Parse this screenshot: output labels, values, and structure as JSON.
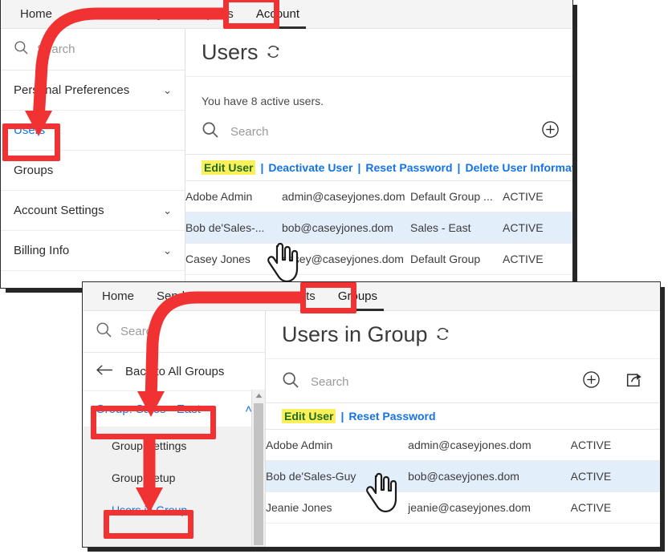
{
  "window_account": {
    "nav": {
      "items": [
        {
          "label": "Home",
          "active": false
        },
        {
          "label": "Send",
          "active": false
        },
        {
          "label": "Manage",
          "active": false
        },
        {
          "label": "Reports",
          "active": false
        },
        {
          "label": "Account",
          "active": true
        }
      ]
    },
    "sidebar": {
      "search_placeholder": "Search",
      "search_icon": "search-icon",
      "items": [
        {
          "label": "Personal Preferences",
          "chevron": "⌄",
          "link": false
        },
        {
          "label": "Users",
          "chevron": "",
          "link": true
        },
        {
          "label": "Groups",
          "chevron": "",
          "link": false
        },
        {
          "label": "Account Settings",
          "chevron": "⌄",
          "link": false
        },
        {
          "label": "Billing Info",
          "chevron": "⌄",
          "link": false
        }
      ]
    },
    "pane": {
      "title": "Users",
      "refresh_icon": "refresh-icon",
      "count_text": "You have 8 active users.",
      "search_placeholder": "Search",
      "add_icon": "plus-circle-icon",
      "actions": [
        {
          "label": "Edit User",
          "highlighted": true
        },
        {
          "label": "Deactivate User",
          "highlighted": false
        },
        {
          "label": "Reset Password",
          "highlighted": false
        },
        {
          "label": "Delete User Information",
          "highlighted": false
        }
      ],
      "action_separator": "|",
      "rows": [
        {
          "name": "Adobe Admin",
          "email": "admin@caseyjones.dom",
          "group": "Default Group ...",
          "status": "ACTIVE",
          "selected": false
        },
        {
          "name": "Bob de'Sales-...",
          "email": "bob@caseyjones.dom",
          "group": "Sales - East",
          "status": "ACTIVE",
          "selected": true
        },
        {
          "name": "Casey Jones",
          "email": "casey@caseyjones.dom",
          "group": "Default Group",
          "status": "ACTIVE",
          "selected": false
        }
      ]
    }
  },
  "window_groups": {
    "nav": {
      "items": [
        {
          "label": "Home",
          "active": false
        },
        {
          "label": "Send",
          "active": false
        },
        {
          "label": "Manage",
          "active": false
        },
        {
          "label": "Reports",
          "active": false
        },
        {
          "label": "Groups",
          "active": true
        }
      ]
    },
    "sidebar": {
      "search_placeholder": "Search",
      "search_icon": "search-icon",
      "back_label": "Back to All Groups",
      "back_icon": "arrow-left-icon",
      "group_label": "Group: Sales - East",
      "group_chevron": "˄",
      "sub_items": [
        {
          "label": "Group Settings",
          "link": false
        },
        {
          "label": "Group Setup",
          "link": false
        },
        {
          "label": "Users in Group",
          "link": true
        }
      ],
      "scrollbar_up_icon": "triangle-up-icon"
    },
    "pane": {
      "title": "Users in Group",
      "refresh_icon": "refresh-icon",
      "search_placeholder": "Search",
      "add_icon": "plus-circle-icon",
      "export_icon": "share-export-icon",
      "actions": [
        {
          "label": "Edit User",
          "highlighted": true
        },
        {
          "label": "Reset Password",
          "highlighted": false
        }
      ],
      "action_separator": "|",
      "rows": [
        {
          "name": "Adobe Admin",
          "email": "admin@caseyjones.dom",
          "status": "ACTIVE",
          "selected": false
        },
        {
          "name": "Bob de'Sales-Guy",
          "email": "bob@caseyjones.dom",
          "status": "ACTIVE",
          "selected": true
        },
        {
          "name": "Jeanie Jones",
          "email": "jeanie@caseyjones.dom",
          "status": "ACTIVE",
          "selected": false
        }
      ]
    }
  },
  "annotations": {
    "highlight_color": "#f03232",
    "boxes": [
      {
        "name": "account-tab-highlight"
      },
      {
        "name": "users-sidebar-highlight"
      },
      {
        "name": "groups-tab-highlight"
      },
      {
        "name": "group-sales-east-highlight"
      },
      {
        "name": "users-in-group-highlight"
      }
    ],
    "arrows": [
      {
        "name": "arrow-account-to-users"
      },
      {
        "name": "arrow-groups-to-group-sales-east"
      },
      {
        "name": "arrow-group-to-users-in-group"
      }
    ],
    "cursors": [
      {
        "name": "hand-cursor-top"
      },
      {
        "name": "hand-cursor-bottom"
      }
    ]
  }
}
